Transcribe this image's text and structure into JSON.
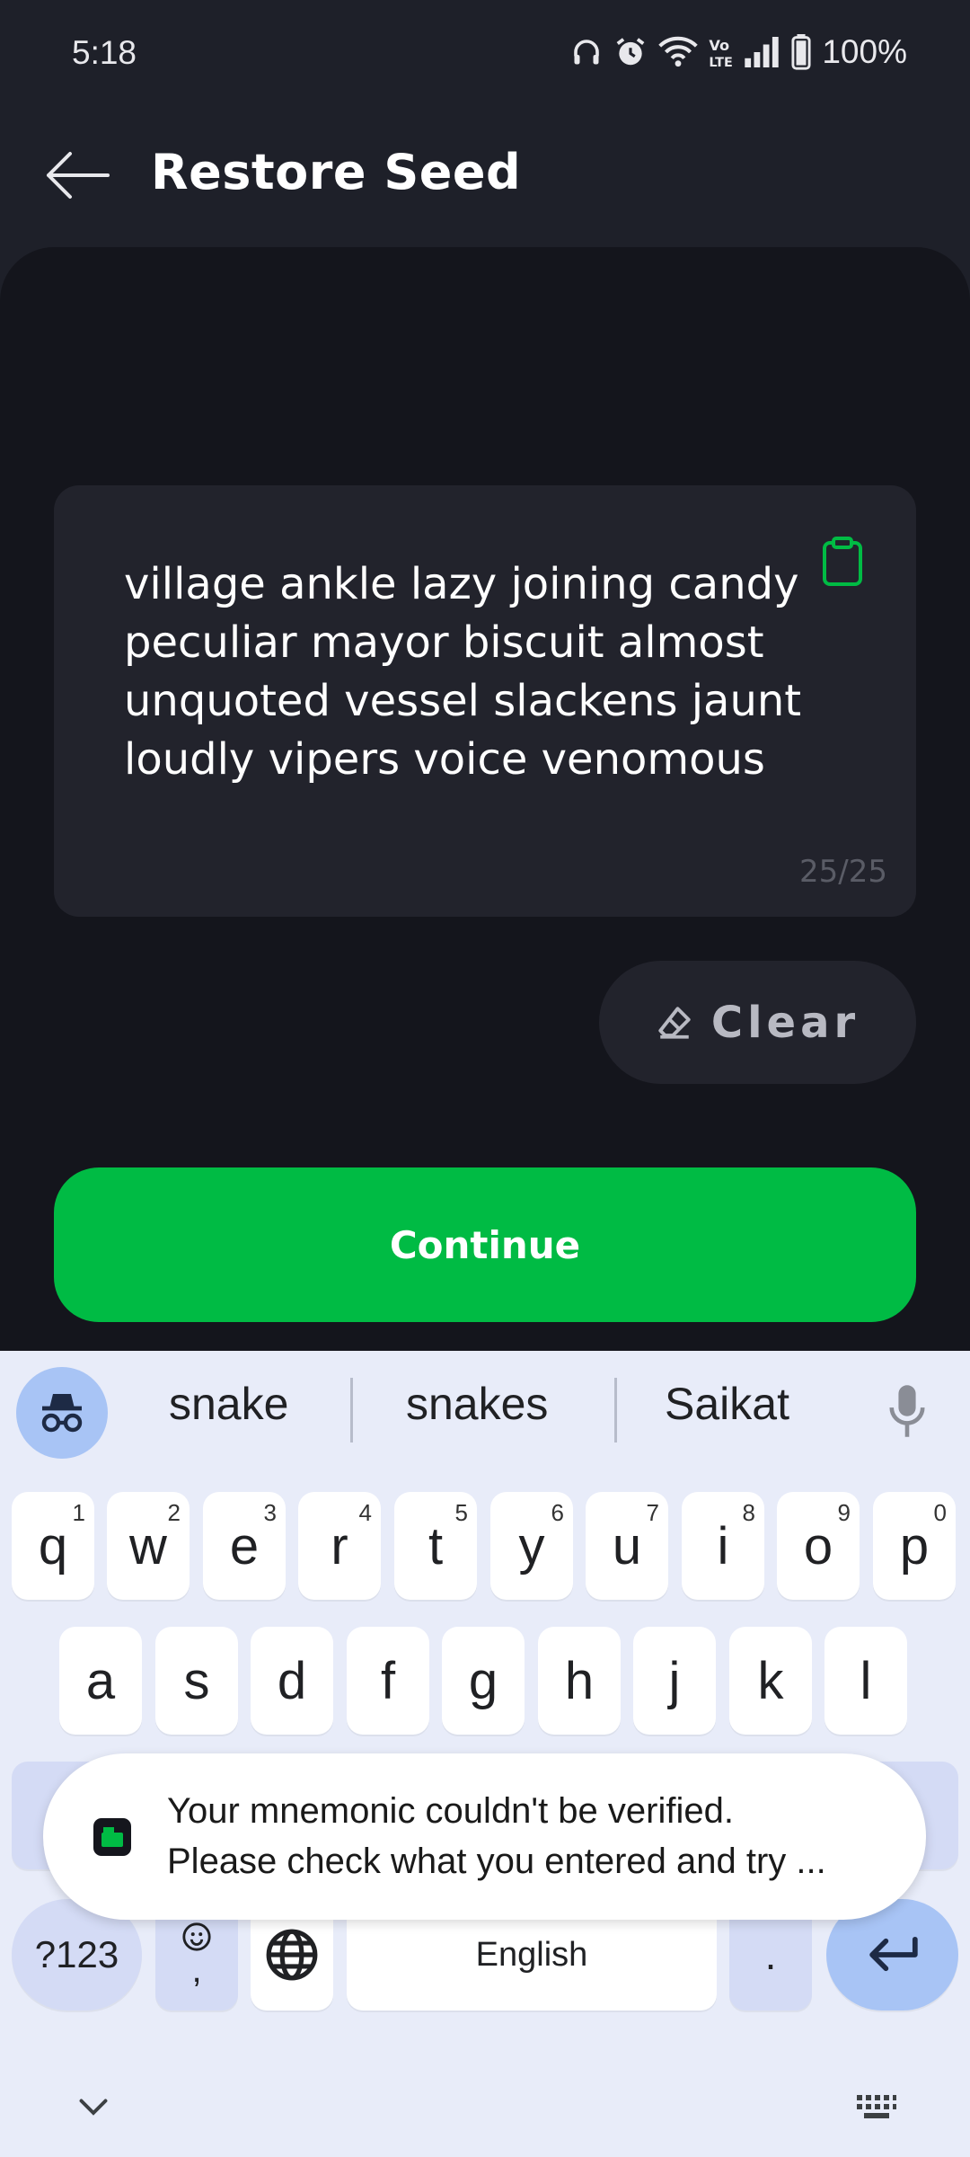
{
  "status_bar": {
    "time": "5:18",
    "battery": "100%",
    "icons": [
      "headphones-icon",
      "alarm-icon",
      "wifi-icon",
      "volte-icon",
      "signal-icon",
      "battery-icon"
    ]
  },
  "header": {
    "title": "Restore Seed",
    "back_icon": "arrow-left-icon"
  },
  "seed_input": {
    "value": "village ankle lazy joining candy peculiar mayor biscuit almost unquoted vessel slackens jaunt loudly vipers voice venomous",
    "counter": "25/25",
    "paste_icon": "clipboard-icon"
  },
  "clear_button": {
    "label": "Clear",
    "icon": "eraser-icon"
  },
  "continue_button": {
    "label": "Continue"
  },
  "colors": {
    "background": "#1e2029",
    "panel": "#14151c",
    "surface": "#22232c",
    "accent": "#00bb44",
    "keyboard": "#e8ecf9"
  },
  "keyboard": {
    "suggestions": [
      "snake",
      "snakes",
      "Saikat"
    ],
    "row1": [
      {
        "k": "q",
        "n": "1"
      },
      {
        "k": "w",
        "n": "2"
      },
      {
        "k": "e",
        "n": "3"
      },
      {
        "k": "r",
        "n": "4"
      },
      {
        "k": "t",
        "n": "5"
      },
      {
        "k": "y",
        "n": "6"
      },
      {
        "k": "u",
        "n": "7"
      },
      {
        "k": "i",
        "n": "8"
      },
      {
        "k": "o",
        "n": "9"
      },
      {
        "k": "p",
        "n": "0"
      }
    ],
    "row2": [
      "a",
      "s",
      "d",
      "f",
      "g",
      "h",
      "j",
      "k",
      "l"
    ],
    "symbols_label": "?123",
    "comma": ",",
    "space_label": "English",
    "period": "."
  },
  "toast": {
    "line1": "Your mnemonic couldn't be verified.",
    "line2": "Please check what you entered and try ..."
  }
}
